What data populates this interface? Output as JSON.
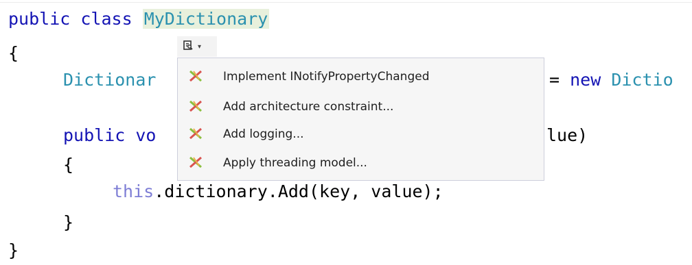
{
  "code": {
    "line1": {
      "kw1": "public",
      "kw2": "class",
      "class_name": "MyDictionary"
    },
    "line2": {
      "brace": "{"
    },
    "line3": {
      "type_prefix": "Dictionar",
      "rest_kw": "= ",
      "rest_new": "new",
      "rest_type": " Dictio"
    },
    "line4": {
      "kw1": "public",
      "vo": " vo",
      "rest": "lue)"
    },
    "line5": {
      "brace": "{"
    },
    "line6": {
      "this_kw": "this",
      "rest": ".dictionary.Add(key, value);"
    },
    "line7": {
      "brace": "}"
    },
    "line8": {
      "brace": "}"
    }
  },
  "smart_tag": {
    "icon": "smart-tag-icon",
    "chevron": "▾"
  },
  "menu": {
    "items": [
      {
        "label": "Implement INotifyPropertyChanged",
        "icon": "postsharp-icon"
      },
      {
        "label": "Add architecture constraint...",
        "icon": "postsharp-icon"
      },
      {
        "label": "Add logging...",
        "icon": "postsharp-icon"
      },
      {
        "label": "Apply threading model...",
        "icon": "postsharp-icon"
      }
    ]
  },
  "colors": {
    "keyword": "#1414b4",
    "type": "#2b91af",
    "menu_background": "#f6f6f6",
    "menu_border": "#cccedb",
    "class_highlight": "#e8f0dc"
  }
}
